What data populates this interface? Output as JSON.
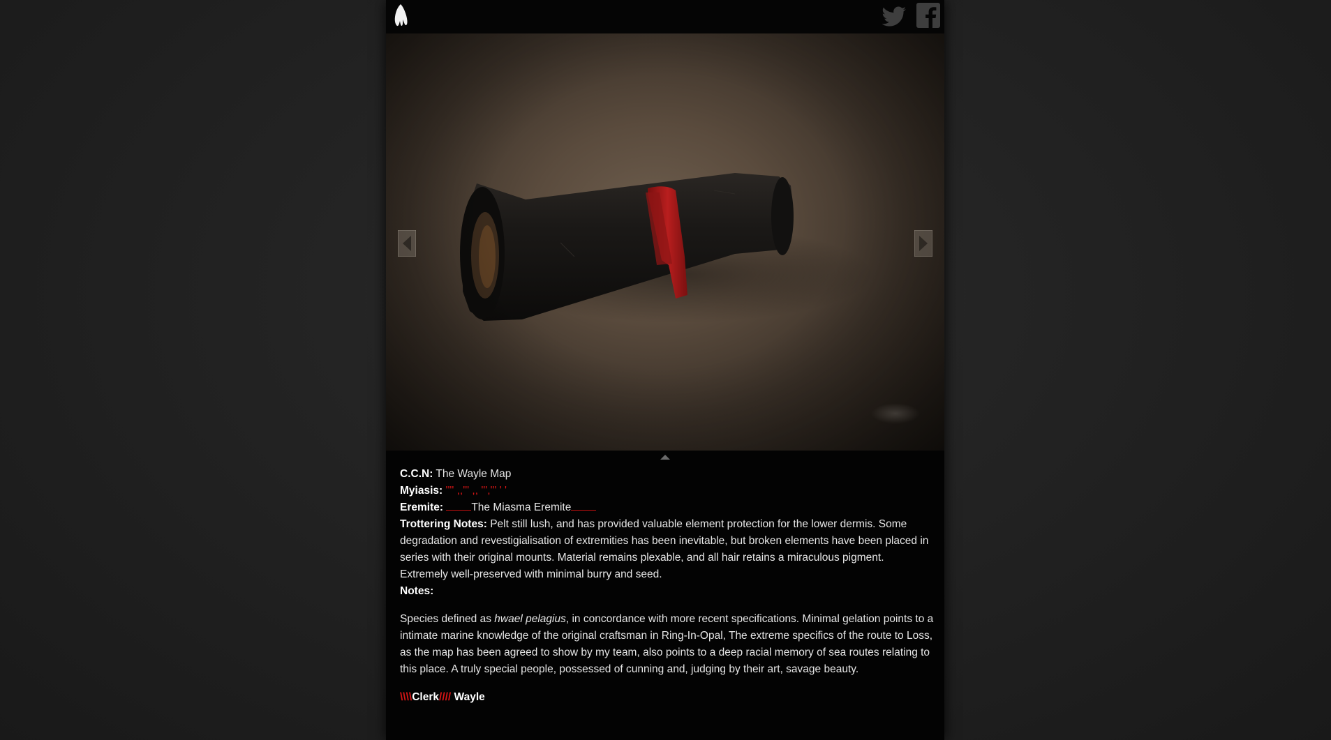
{
  "header": {
    "logo_icon": "tooth-logo-icon",
    "social": [
      {
        "name": "twitter",
        "icon": "twitter-bird-icon"
      },
      {
        "name": "facebook",
        "icon": "facebook-f-icon"
      }
    ]
  },
  "gallery": {
    "prev_icon": "triangle-left-icon",
    "next_icon": "triangle-right-icon",
    "collapse_icon": "triangle-up-icon"
  },
  "details": {
    "ccn_label": "C.C.N:",
    "ccn_value": "The Wayle Map",
    "myiasis_label": "Myiasis:",
    "myiasis_value": "'''' ,,''' ,, ''',''' ' '",
    "eremite_label": "Eremite:",
    "eremite_value": "The Miasma Eremite",
    "trottering_label": "Trottering Notes:",
    "trottering_value": "Pelt still lush, and has provided valuable element protection for the lower dermis. Some degradation and revestigialisation of extremities has been inevitable, but broken elements have been placed in series with their original mounts. Material remains plexable, and all hair retains a miraculous pigment. Extremely well-preserved with minimal burry and seed.",
    "notes_label": "Notes:",
    "notes_pre": "Species defined as ",
    "notes_italic": "hwael pelagius",
    "notes_post": ", in concordance with more recent specifications. Minimal gelation points to a intimate marine knowledge of the original craftsman in Ring-In-Opal, The extreme specifics of the route to Loss, as the map has been agreed to show by my team, also points to a deep racial memory of sea routes relating to this place. A truly special people, possessed of cunning and, judging by their art, savage beauty.",
    "sig_mark_left": "\\\\\\\\",
    "sig_role": "Clerk",
    "sig_mark_right": "////",
    "sig_name": " Wayle"
  },
  "colors": {
    "accent_red": "#d81515",
    "panel_bg": "#030303",
    "page_bg": "#232323"
  }
}
